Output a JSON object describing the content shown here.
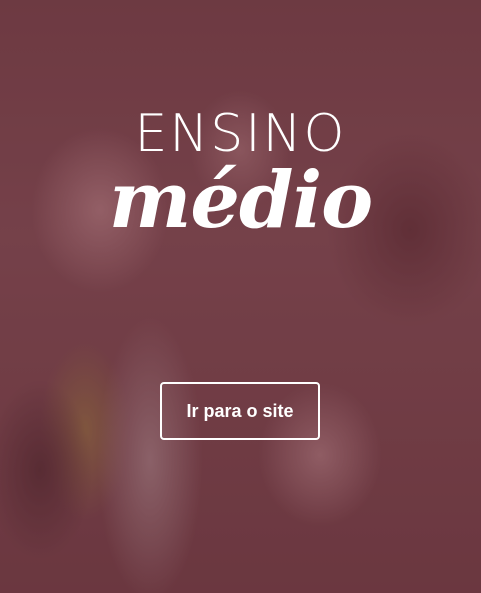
{
  "banner": {
    "title_line1": "ENSINO",
    "title_line2": "médio",
    "cta_label": "Ir para o site",
    "colors": {
      "overlay": "#7a4a51",
      "text": "#ffffff"
    }
  }
}
